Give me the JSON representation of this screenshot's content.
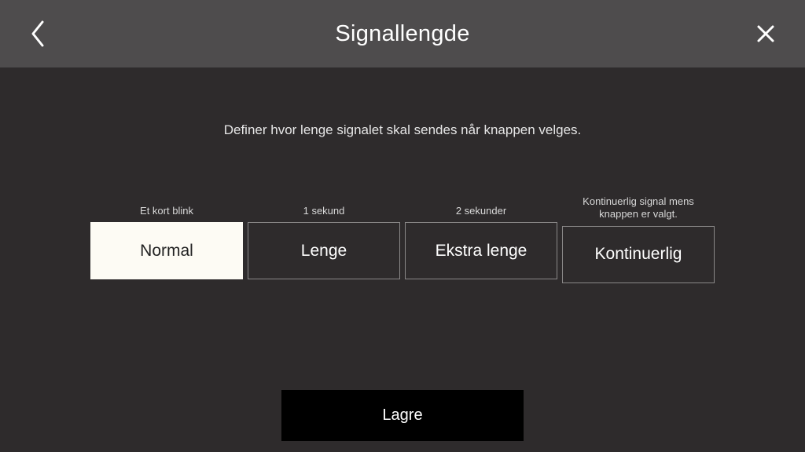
{
  "header": {
    "title": "Signallengde"
  },
  "description": "Definer hvor lenge signalet skal sendes når knappen velges.",
  "options": [
    {
      "label": "Et kort blink",
      "button": "Normal",
      "selected": true
    },
    {
      "label": "1 sekund",
      "button": "Lenge",
      "selected": false
    },
    {
      "label": "2 sekunder",
      "button": "Ekstra lenge",
      "selected": false
    },
    {
      "label": "Kontinuerlig signal mens knappen er valgt.",
      "button": "Kontinuerlig",
      "selected": false
    }
  ],
  "save_label": "Lagre"
}
